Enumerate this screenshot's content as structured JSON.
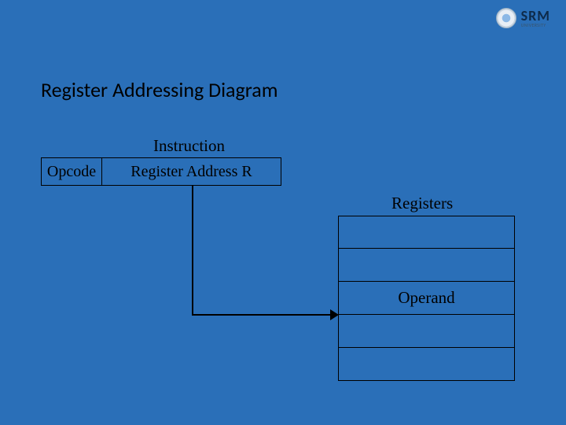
{
  "logo": {
    "main": "SRM",
    "sub": "UNIVERSITY"
  },
  "title": "Register Addressing Diagram",
  "labels": {
    "instruction": "Instruction",
    "registers": "Registers"
  },
  "instruction": {
    "opcode": "Opcode",
    "register_address": "Register Address R"
  },
  "register_rows": [
    "",
    "",
    "Operand",
    "",
    ""
  ]
}
